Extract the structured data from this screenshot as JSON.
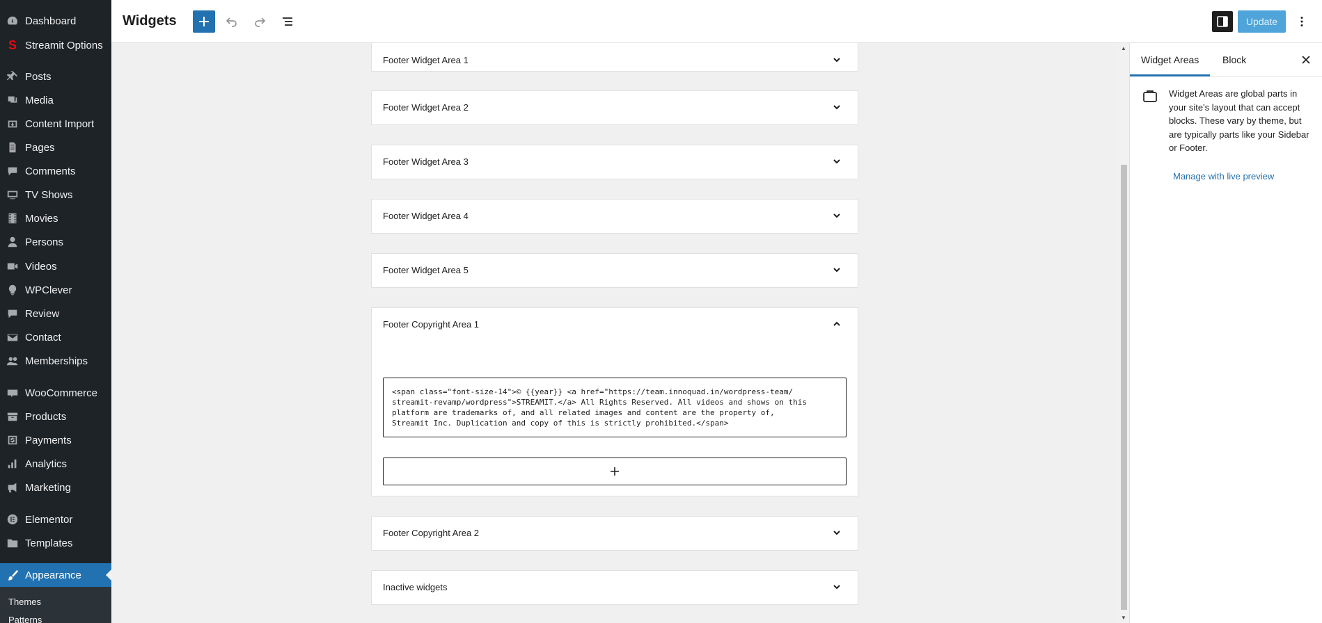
{
  "header": {
    "title": "Widgets",
    "update_label": "Update"
  },
  "sidebar": {
    "items": [
      {
        "label": "Dashboard",
        "icon": "dashboard-icon"
      },
      {
        "label": "Streamit Options",
        "icon": "streamit-logo-icon"
      },
      {
        "label": "Posts",
        "icon": "pin-icon"
      },
      {
        "label": "Media",
        "icon": "media-icon"
      },
      {
        "label": "Content Import",
        "icon": "import-icon"
      },
      {
        "label": "Pages",
        "icon": "page-icon"
      },
      {
        "label": "Comments",
        "icon": "comment-icon"
      },
      {
        "label": "TV Shows",
        "icon": "tv-icon"
      },
      {
        "label": "Movies",
        "icon": "film-icon"
      },
      {
        "label": "Persons",
        "icon": "person-icon"
      },
      {
        "label": "Videos",
        "icon": "video-icon"
      },
      {
        "label": "WPClever",
        "icon": "lightbulb-icon"
      },
      {
        "label": "Review",
        "icon": "comment-icon"
      },
      {
        "label": "Contact",
        "icon": "mail-icon"
      },
      {
        "label": "Memberships",
        "icon": "group-icon"
      },
      {
        "label": "WooCommerce",
        "icon": "woo-icon"
      },
      {
        "label": "Products",
        "icon": "archive-icon"
      },
      {
        "label": "Payments",
        "icon": "dollar-icon"
      },
      {
        "label": "Analytics",
        "icon": "bar-chart-icon"
      },
      {
        "label": "Marketing",
        "icon": "megaphone-icon"
      },
      {
        "label": "Elementor",
        "icon": "elementor-icon"
      },
      {
        "label": "Templates",
        "icon": "folder-icon"
      },
      {
        "label": "Appearance",
        "icon": "brush-icon"
      }
    ],
    "submenu": [
      "Themes",
      "Patterns"
    ]
  },
  "widget_areas": [
    {
      "title": "Footer Widget Area 1",
      "expanded": false
    },
    {
      "title": "Footer Widget Area 2",
      "expanded": false
    },
    {
      "title": "Footer Widget Area 3",
      "expanded": false
    },
    {
      "title": "Footer Widget Area 4",
      "expanded": false
    },
    {
      "title": "Footer Widget Area 5",
      "expanded": false
    },
    {
      "title": "Footer Copyright Area 1",
      "expanded": true
    },
    {
      "title": "Footer Copyright Area 2",
      "expanded": false
    },
    {
      "title": "Inactive widgets",
      "expanded": false
    }
  ],
  "html_block": {
    "content": "<span class=\"font-size-14\">© {{year}} <a href=\"https://team.innoquad.in/wordpress-team/\nstreamit-revamp/wordpress\">STREAMIT.</a> All Rights Reserved. All videos and shows on this\nplatform are trademarks of, and all related images and content are the property of,\nStreamit Inc. Duplication and copy of this is strictly prohibited.</span>"
  },
  "side_panel": {
    "tabs": [
      "Widget Areas",
      "Block"
    ],
    "description": "Widget Areas are global parts in your site's layout that can accept blocks. These vary by theme, but are typically parts like your Sidebar or Footer.",
    "link": "Manage with live preview"
  },
  "colors": {
    "admin_sidebar": "#1d2327",
    "accent": "#2271b1",
    "update_button": "#4fa4da"
  }
}
